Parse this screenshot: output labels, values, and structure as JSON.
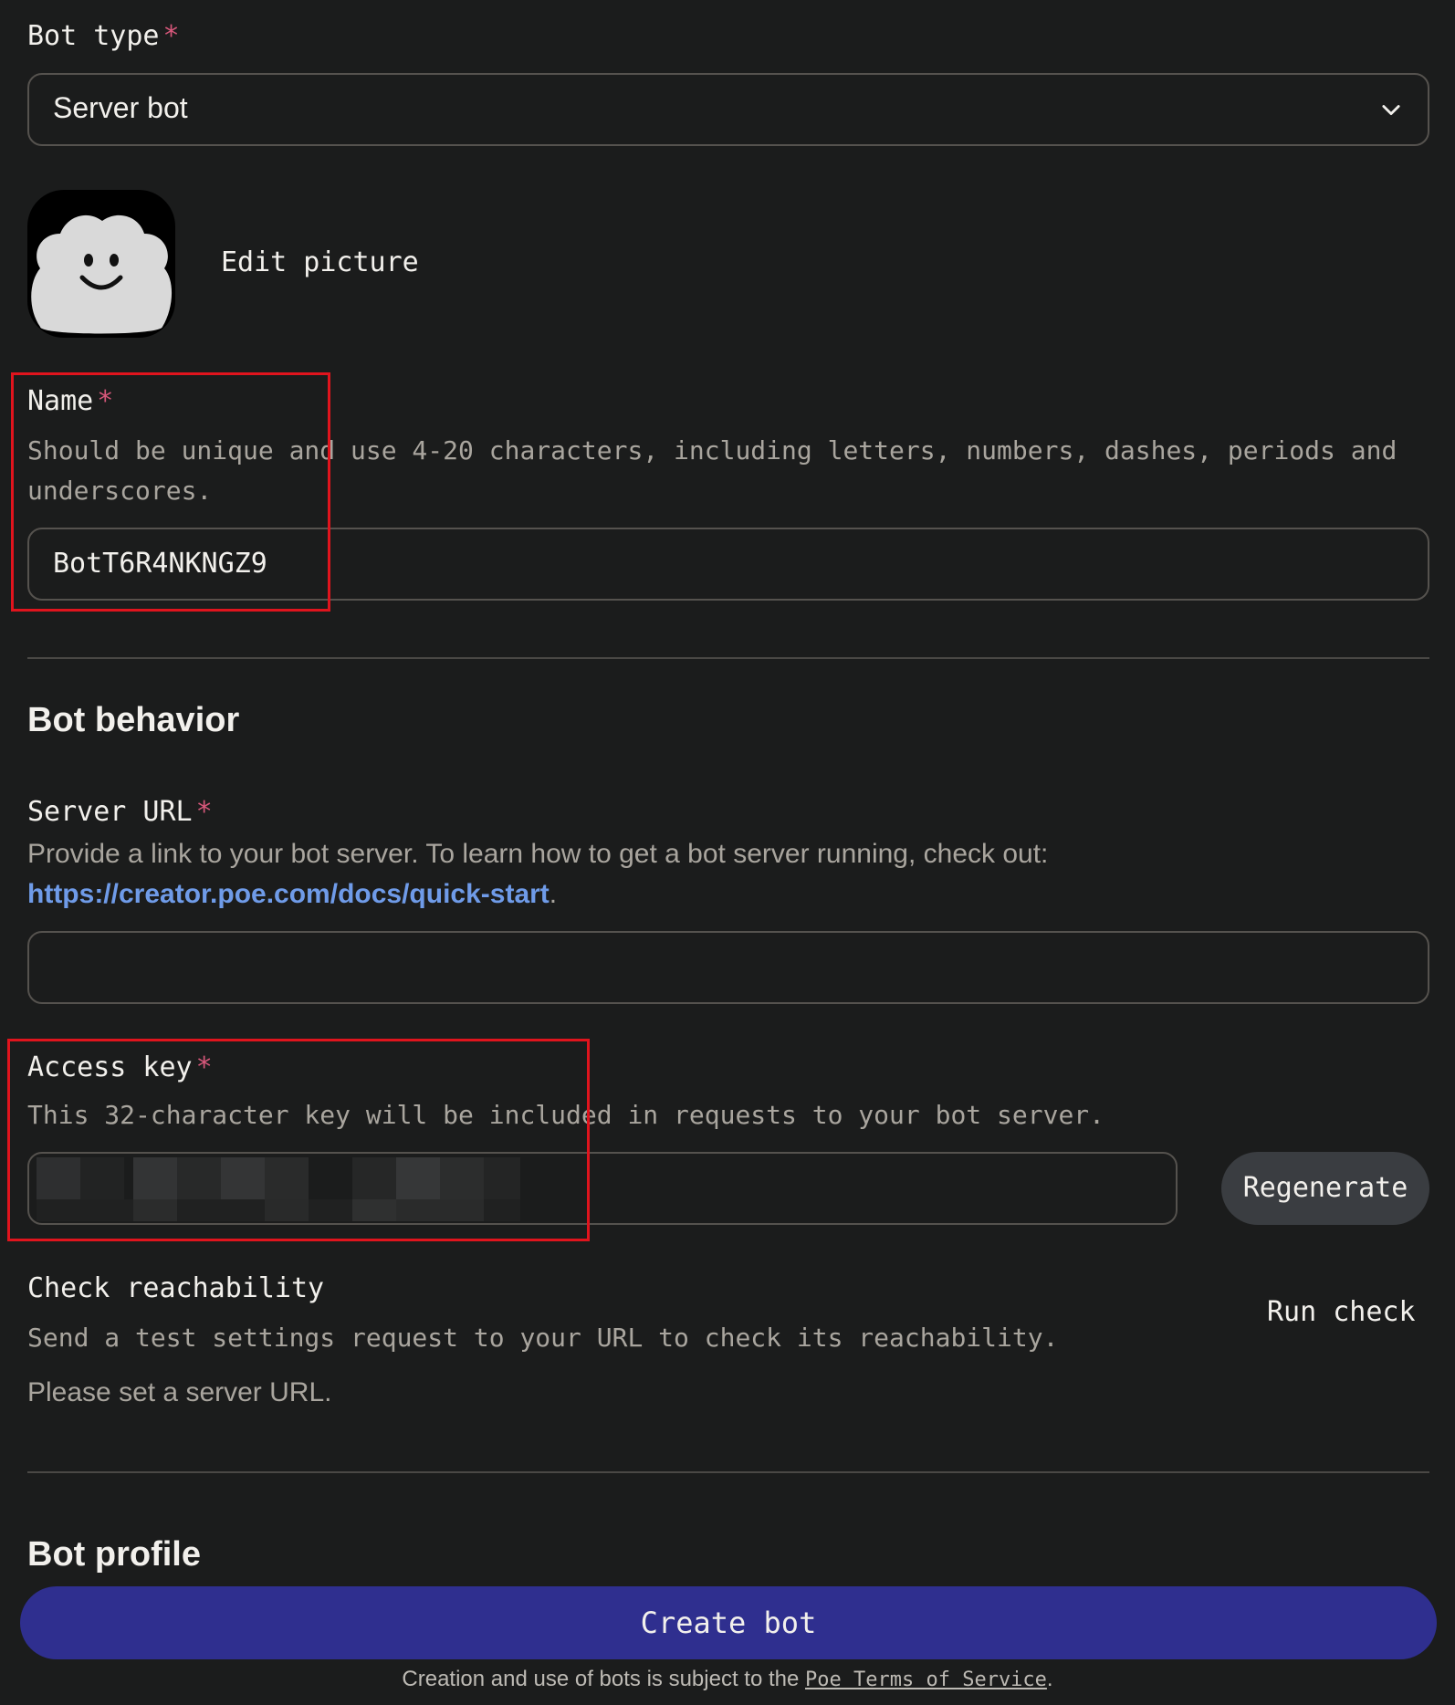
{
  "bot_type": {
    "label": "Bot type",
    "required_mark": "*",
    "selected": "Server bot"
  },
  "avatar": {
    "edit_label": "Edit picture"
  },
  "name": {
    "label": "Name",
    "required_mark": "*",
    "hint_line1": "Should be unique and use 4-20 characters, including letters, numbers, dashes, periods and",
    "hint_line2": "underscores.",
    "value": "BotT6R4NKNGZ9"
  },
  "bot_behavior": {
    "heading": "Bot behavior",
    "server_url": {
      "label": "Server URL",
      "required_mark": "*",
      "hint": "Provide a link to your bot server. To learn how to get a bot server running, check out:",
      "link": "https://creator.poe.com/docs/quick-start",
      "link_suffix": ".",
      "value": ""
    },
    "access_key": {
      "label": "Access key",
      "required_mark": "*",
      "hint": "This 32-character key will be included in requests to your bot server.",
      "regenerate_label": "Regenerate"
    },
    "reachability": {
      "label": "Check reachability",
      "hint": "Send a test settings request to your URL to check its reachability.",
      "status": "Please set a server URL.",
      "run_label": "Run check"
    }
  },
  "bot_profile": {
    "heading": "Bot profile"
  },
  "footer": {
    "create_label": "Create bot",
    "terms_prefix": "Creation and use of bots is subject to the ",
    "terms_link": "Poe Terms of Service",
    "terms_suffix": "."
  },
  "colors": {
    "background": "#1b1c1c",
    "required": "#d6577a",
    "link": "#6f9be8",
    "primary_button": "#2f2f8f",
    "highlight_box": "#e0141d"
  }
}
